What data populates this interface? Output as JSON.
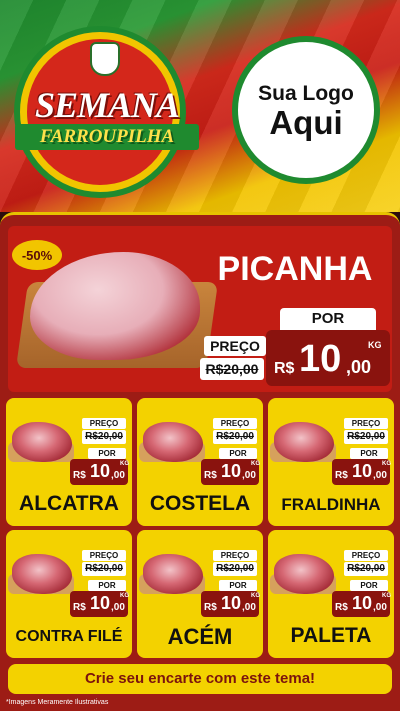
{
  "header": {
    "event_title_1": "SEMANA",
    "event_title_2": "FARROUPILHA",
    "logo_line_1": "Sua Logo",
    "logo_line_2": "Aqui"
  },
  "colors": {
    "green": "#1f8a2f",
    "red": "#c21d14",
    "yellow": "#f3d200",
    "dark_red": "#8a130e"
  },
  "hero": {
    "discount": "-50%",
    "name": "PICANHA",
    "preco_label": "PREÇO",
    "old_price": "R$20,00",
    "por_label": "POR",
    "currency": "R$",
    "price_int": "10",
    "price_dec": ",00",
    "unit": "KG"
  },
  "products": [
    {
      "name": "ALCATRA",
      "preco_label": "PREÇO",
      "old_price": "R$20,00",
      "por_label": "POR",
      "currency": "R$",
      "price_int": "10",
      "price_dec": ",00",
      "unit": "KG"
    },
    {
      "name": "COSTELA",
      "preco_label": "PREÇO",
      "old_price": "R$20,00",
      "por_label": "POR",
      "currency": "R$",
      "price_int": "10",
      "price_dec": ",00",
      "unit": "KG"
    },
    {
      "name": "FRALDINHA",
      "preco_label": "PREÇO",
      "old_price": "R$20,00",
      "por_label": "POR",
      "currency": "R$",
      "price_int": "10",
      "price_dec": ",00",
      "unit": "KG"
    },
    {
      "name": "CONTRA FILÉ",
      "preco_label": "PREÇO",
      "old_price": "R$20,00",
      "por_label": "POR",
      "currency": "R$",
      "price_int": "10",
      "price_dec": ",00",
      "unit": "KG"
    },
    {
      "name": "ACÉM",
      "preco_label": "PREÇO",
      "old_price": "R$20,00",
      "por_label": "POR",
      "currency": "R$",
      "price_int": "10",
      "price_dec": ",00",
      "unit": "KG"
    },
    {
      "name": "PALETA",
      "preco_label": "PREÇO",
      "old_price": "R$20,00",
      "por_label": "POR",
      "currency": "R$",
      "price_int": "10",
      "price_dec": ",00",
      "unit": "KG"
    }
  ],
  "cta": "Crie seu encarte com este tema!",
  "footnote": "*Imagens Meramente Ilustrativas"
}
